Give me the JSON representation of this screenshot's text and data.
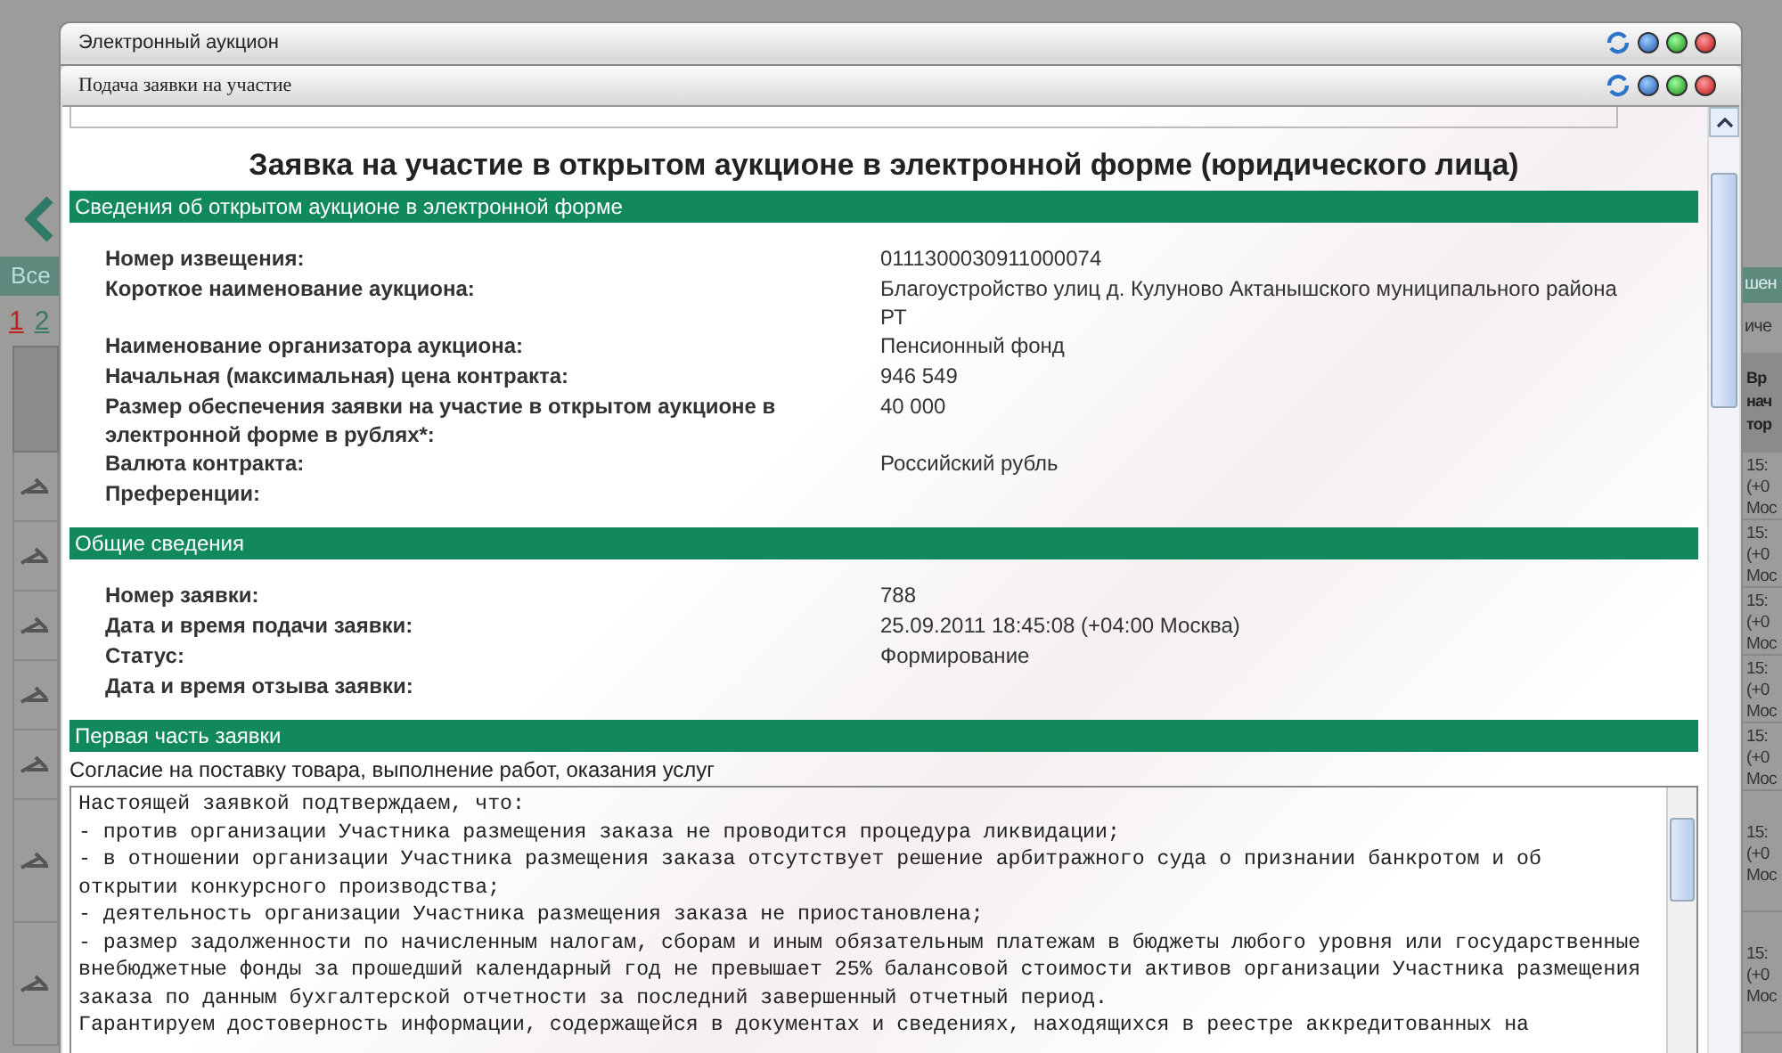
{
  "background": {
    "left_tab": "Все",
    "pages": [
      {
        "label": "1",
        "selected": true
      },
      {
        "label": "2",
        "selected": false
      }
    ],
    "right_tab": "шен",
    "right_label": "иче",
    "right_header": "Вр\nнач\nтор",
    "rows": [
      "15:\n(+0\nМос",
      "15:\n(+0\nМос",
      "15:\n(+0\nМос",
      "15:\n(+0\nМос",
      "15:\n(+0\nМос",
      "15:\n(+0\nМос",
      "15:\n(+0\nМос"
    ]
  },
  "window": {
    "title": "Электронный аукцион"
  },
  "dialog": {
    "title": "Подача заявки на участие",
    "heading": "Заявка на участие в открытом аукционе в электронной форме (юридического лица)",
    "sections": [
      {
        "title": "Сведения об открытом аукционе в электронной форме",
        "fields": [
          {
            "label": "Номер извещения:",
            "value": "0111300030911000074"
          },
          {
            "label": "Короткое наименование аукциона:",
            "value": "Благоустройство улиц д. Кулуново Актанышского муниципального района РТ"
          },
          {
            "label": "Наименование организатора аукциона:",
            "value": "Пенсионный фонд"
          },
          {
            "label": "Начальная (максимальная) цена контракта:",
            "value": "946 549"
          },
          {
            "label": "Размер обеспечения заявки на участие в открытом аукционе в электронной форме в рублях*:",
            "value": "40 000"
          },
          {
            "label": "Валюта контракта:",
            "value": "Российский рубль"
          },
          {
            "label": "Преференции:"
          }
        ]
      },
      {
        "title": "Общие сведения",
        "fields": [
          {
            "label": "Номер заявки:",
            "value": "788"
          },
          {
            "label": "Дата и время подачи заявки:",
            "value": "25.09.2011 18:45:08 (+04:00 Москва)"
          },
          {
            "label": "Статус:",
            "value": "Формирование"
          },
          {
            "label": "Дата и время отзыва заявки:"
          }
        ]
      }
    ],
    "first_part": {
      "title": "Первая часть заявки",
      "caption": "Согласие на поставку товара, выполнение работ, оказания услуг",
      "text": "Настоящей заявкой подтверждаем, что:\n- против организации Участника размещения заказа не проводится процедура ликвидации;\n- в отношении организации Участника размещения заказа отсутствует решение арбитражного суда о признании банкротом и об\nоткрытии конкурсного производства;\n- деятельность организации Участника размещения заказа не приостановлена;\n- размер задолженности по начисленным налогам, сборам и иным обязательным платежам в бюджеты любого уровня или государственные\nвнебюджетные фонды за прошедший календарный год не превышает 25% балансовой стоимости активов организации Участника размещения\nзаказа по данным бухгалтерской отчетности за последний завершенный отчетный период.\nГарантируем достоверность информации, содержащейся в документах и сведениях, находящихся в реестре аккредитованных на"
    }
  }
}
